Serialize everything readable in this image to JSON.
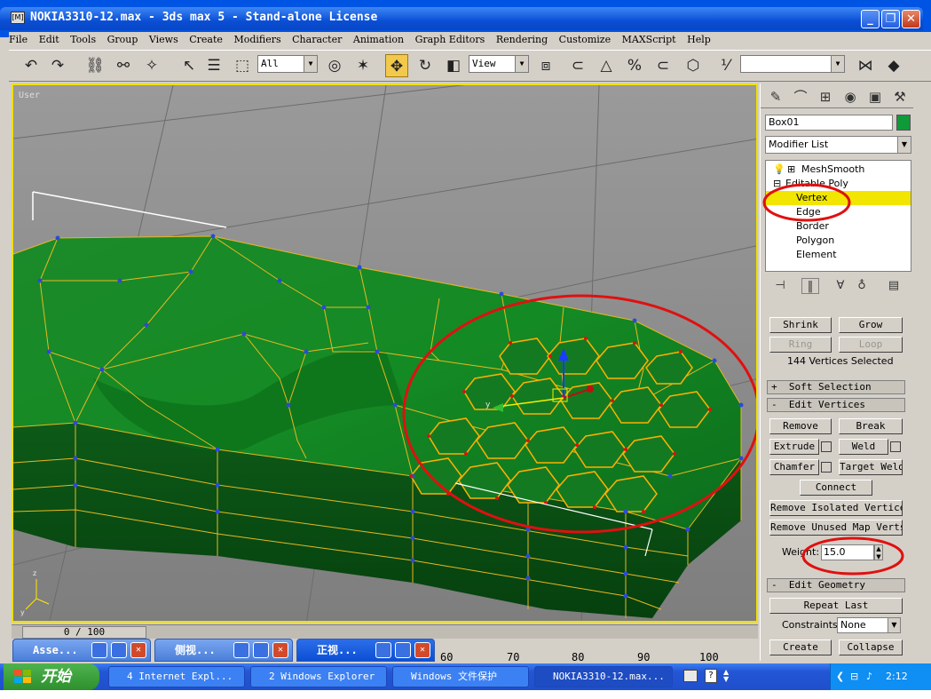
{
  "window": {
    "title": "NOKIA3310-12.max - 3ds max 5 - Stand-alone License",
    "app_icon_label": "[M]",
    "min_icon": "_",
    "max_icon": "❐",
    "close_icon": "✕"
  },
  "menu": [
    "File",
    "Edit",
    "Tools",
    "Group",
    "Views",
    "Create",
    "Modifiers",
    "Character",
    "Animation",
    "Graph Editors",
    "Rendering",
    "Customize",
    "MAXScript",
    "Help"
  ],
  "toolbar": {
    "selection_filter": "All",
    "reference_coord": "View"
  },
  "viewport": {
    "label": "User",
    "accent": "#f0e000"
  },
  "command_panel": {
    "object_name": "Box01",
    "object_color": "#0f9a3a",
    "modifier_list_label": "Modifier List",
    "stack": [
      {
        "label": "MeshSmooth",
        "level": 0
      },
      {
        "label": "Editable Poly",
        "level": 0
      },
      {
        "label": "Vertex",
        "level": 1,
        "selected": true
      },
      {
        "label": "Edge",
        "level": 1
      },
      {
        "label": "Border",
        "level": 1
      },
      {
        "label": "Polygon",
        "level": 1
      },
      {
        "label": "Element",
        "level": 1
      }
    ],
    "selection": {
      "shrink": "Shrink",
      "grow": "Grow",
      "ring": "Ring",
      "loop": "Loop",
      "status": "144 Vertices Selected"
    },
    "soft_selection_header": "Soft Selection",
    "edit_vertices_header": "Edit Vertices",
    "edit_vertices": {
      "remove": "Remove",
      "break": "Break",
      "extrude": "Extrude",
      "weld": "Weld",
      "chamfer": "Chamfer",
      "target_weld": "Target Weld",
      "connect": "Connect",
      "remove_isolated": "Remove Isolated Vertices",
      "remove_unused": "Remove Unused Map Verts",
      "weight_label": "Weight:",
      "weight_value": "15.0"
    },
    "edit_geometry_header": "Edit Geometry",
    "edit_geometry": {
      "repeat_last": "Repeat Last",
      "constraints_label": "Constraints:",
      "constraints_value": "None",
      "create": "Create",
      "collapse": "Collapse"
    }
  },
  "timeline": {
    "frame": "0 / 100",
    "ruler": [
      "60",
      "70",
      "80",
      "90",
      "100"
    ]
  },
  "minimized_windows": [
    {
      "label": "Asse..."
    },
    {
      "label": "侧视..."
    },
    {
      "label": "正视..."
    }
  ],
  "taskbar": {
    "start": "开始",
    "tasks": [
      {
        "label": "4 Internet Expl..."
      },
      {
        "label": "2 Windows Explorer"
      },
      {
        "label": "Windows 文件保护"
      },
      {
        "label": "NOKIA3310-12.max..."
      }
    ],
    "clock": "2:12"
  },
  "annotations": {
    "circle_color": "#e01010"
  }
}
